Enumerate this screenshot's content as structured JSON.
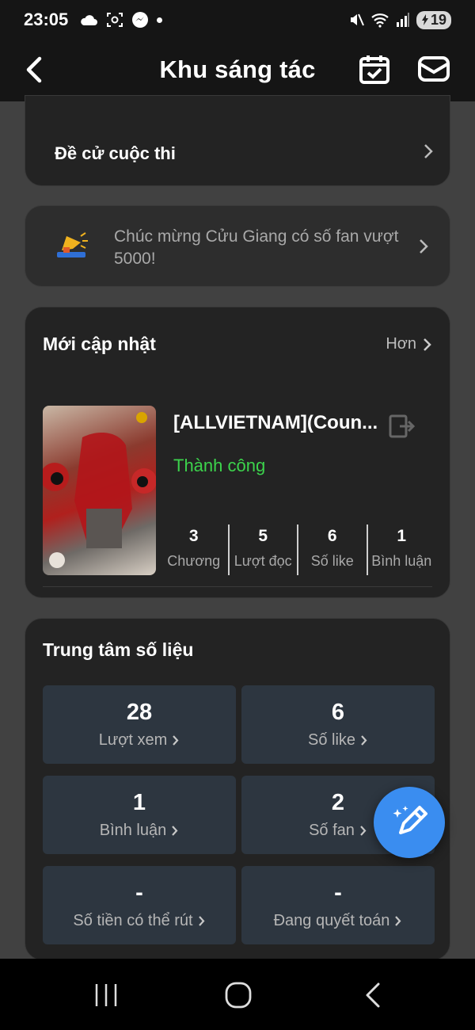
{
  "status_bar": {
    "time": "23:05",
    "battery": "19",
    "icons": [
      "cloud-icon",
      "screenshot-icon",
      "messenger-icon",
      "dot-icon",
      "mute-icon",
      "wifi-icon",
      "signal-icon",
      "battery-icon"
    ]
  },
  "header": {
    "title": "Khu sáng tác",
    "icons": [
      "back-icon",
      "calendar-check-icon",
      "mail-icon"
    ]
  },
  "nominate": {
    "label": "Đề cử cuộc thi"
  },
  "notice": {
    "text": "Chúc mừng Cửu Giang có số fan vượt 5000!",
    "icon": "megaphone-icon"
  },
  "updates": {
    "title": "Mới cập nhật",
    "more_label": "Hơn",
    "book": {
      "title": "[ALLVIETNAM](Coun...",
      "status": "Thành công",
      "stats": [
        {
          "value": "3",
          "label": "Chương"
        },
        {
          "value": "5",
          "label": "Lượt đọc"
        },
        {
          "value": "6",
          "label": "Số like"
        },
        {
          "value": "1",
          "label": "Bình luận"
        }
      ]
    }
  },
  "data_center": {
    "title": "Trung tâm số liệu",
    "tiles": [
      {
        "value": "28",
        "label": "Lượt xem"
      },
      {
        "value": "6",
        "label": "Số like"
      },
      {
        "value": "1",
        "label": "Bình luận"
      },
      {
        "value": "2",
        "label": "Số fan"
      },
      {
        "value": "-",
        "label": "Số tiền có thể rút"
      },
      {
        "value": "-",
        "label": "Đang quyết toán"
      }
    ]
  },
  "colors": {
    "background": "#414141",
    "card": "#232323",
    "tile": "#2d3640",
    "success": "#3cd34c",
    "fab": "#3a8df0"
  }
}
